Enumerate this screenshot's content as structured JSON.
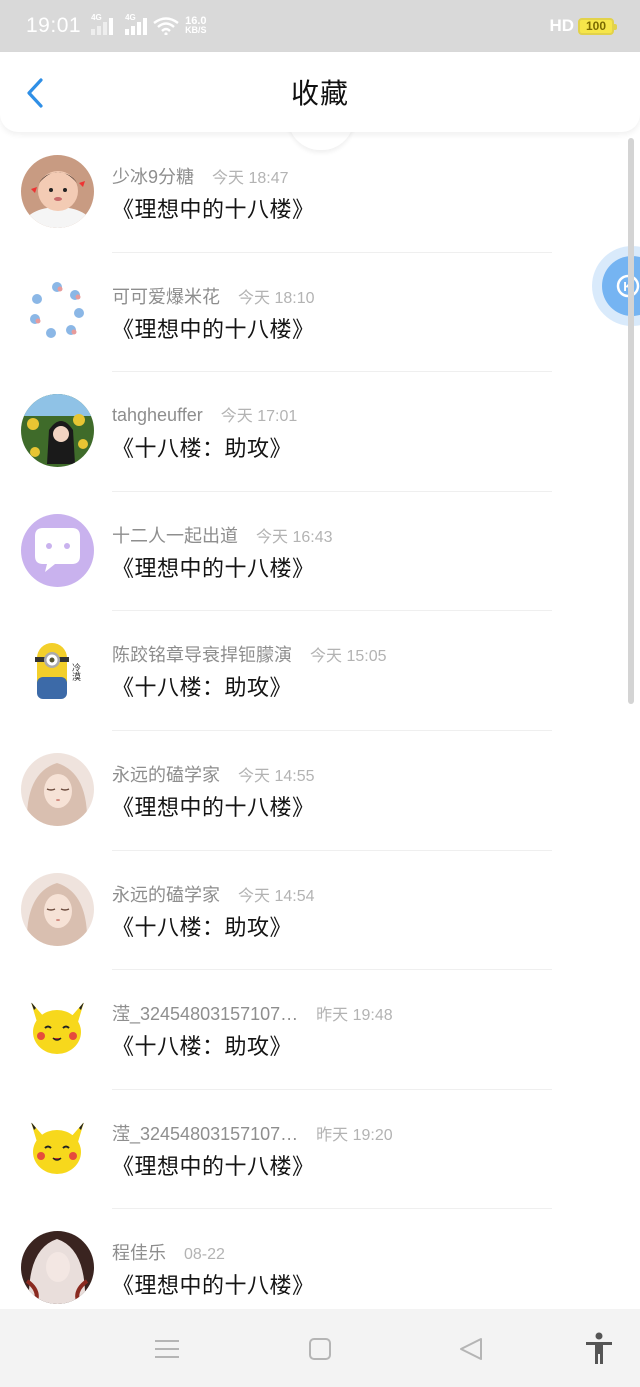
{
  "status_bar": {
    "time": "19:01",
    "net1": "4G",
    "net2": "4G",
    "speed_value": "16.0",
    "speed_unit": "KB/S",
    "hd": "HD",
    "battery": "100"
  },
  "header": {
    "title": "收藏",
    "back_icon": "chevron-left-icon",
    "accent_color": "#2f8fe6"
  },
  "items": [
    {
      "name": "少冰9分糖",
      "time": "今天 18:47",
      "title": "《理想中的十八楼》",
      "avatar": "baby-photo"
    },
    {
      "name": "可可爱爆米花",
      "time": "今天 18:10",
      "title": "《理想中的十八楼》",
      "avatar": "cartoon-ring"
    },
    {
      "name": "tahgheuffer",
      "time": "今天 17:01",
      "title": "《十八楼：助攻》",
      "avatar": "girl-sunflowers"
    },
    {
      "name": "十二人一起出道",
      "time": "今天 16:43",
      "title": "《理想中的十八楼》",
      "avatar": "chat-bubble"
    },
    {
      "name": "陈跤铭章导衰捍钷朦演",
      "time": "今天 15:05",
      "title": "《十八楼：助攻》",
      "avatar": "minion",
      "avatar_text": "冷漠"
    },
    {
      "name": "永远的磕学家",
      "time": "今天 14:55",
      "title": "《理想中的十八楼》",
      "avatar": "anime-girl"
    },
    {
      "name": "永远的磕学家",
      "time": "今天 14:54",
      "title": "《十八楼：助攻》",
      "avatar": "anime-girl"
    },
    {
      "name": "滢_32454803157107…",
      "time": "昨天 19:48",
      "title": "《十八楼：助攻》",
      "avatar": "pikachu"
    },
    {
      "name": "滢_32454803157107…",
      "time": "昨天 19:20",
      "title": "《理想中的十八楼》",
      "avatar": "pikachu"
    },
    {
      "name": "程佳乐",
      "time": "08-22",
      "title": "《理想中的十八楼》",
      "avatar": "dark-anime"
    }
  ],
  "float_button": {
    "label": "K",
    "icon": "floating-assistant-icon"
  },
  "nav_bar": {
    "icons": [
      "menu-icon",
      "home-icon",
      "back-icon",
      "accessibility-icon"
    ]
  }
}
